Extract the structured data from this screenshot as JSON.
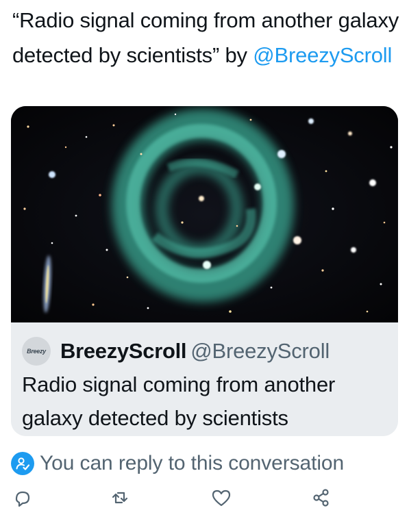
{
  "tweet": {
    "text_quote": "“Radio signal coming from another galaxy detected by scientists” by ",
    "mention": "@BreezyScroll"
  },
  "card": {
    "image_icon": "radio-galaxy-photo",
    "avatar_text": "Breezy",
    "author_name": "BreezyScroll",
    "author_handle": "@BreezyScroll",
    "title": "Radio signal coming from another galaxy detected by scientists"
  },
  "reply_notice": {
    "icon": "person-check-icon",
    "text": "You can reply to this conversation"
  },
  "actions": [
    {
      "name": "reply",
      "icon": "comment-icon"
    },
    {
      "name": "retweet",
      "icon": "retweet-icon"
    },
    {
      "name": "like",
      "icon": "heart-icon"
    },
    {
      "name": "share",
      "icon": "share-icon"
    }
  ],
  "colors": {
    "accent": "#1d9bf0",
    "text": "#0f1419",
    "secondary_text": "#536471",
    "card_background": "#eaedf0"
  }
}
